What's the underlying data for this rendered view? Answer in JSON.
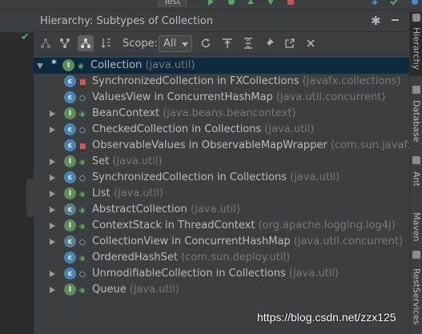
{
  "topbar": {
    "run_config": "Test"
  },
  "panel": {
    "title": "Hierarchy:  Subtypes of Collection"
  },
  "toolbar": {
    "scope_label": "Scope:",
    "scope_value": "All"
  },
  "tree": [
    {
      "indent": 0,
      "expander": "down",
      "star": "*",
      "icon": "interface",
      "letter": "I",
      "badge": "pub",
      "name": "Collection",
      "pkg": "(java.util)",
      "selected": true
    },
    {
      "indent": 1,
      "expander": "",
      "icon": "klass",
      "letter": "c",
      "badge": "priv",
      "name": "SynchronizedCollection in FXCollections",
      "pkg": "(javafx.collections)"
    },
    {
      "indent": 1,
      "expander": "",
      "icon": "klass",
      "letter": "c",
      "badge": "pkg",
      "name": "ValuesView in ConcurrentHashMap",
      "pkg": "(java.util.concurrent)"
    },
    {
      "indent": 1,
      "expander": "right",
      "icon": "interface",
      "letter": "I",
      "badge": "pub",
      "name": "BeanContext",
      "pkg": "(java.beans.beancontext)"
    },
    {
      "indent": 1,
      "expander": "right",
      "icon": "klass",
      "letter": "c",
      "badge": "pkg",
      "name": "CheckedCollection in Collections",
      "pkg": "(java.util)"
    },
    {
      "indent": 1,
      "expander": "",
      "icon": "klass",
      "letter": "c",
      "badge": "priv",
      "name": "ObservableValues in ObservableMapWrapper",
      "pkg": "(com.sun.javafx.collections)"
    },
    {
      "indent": 1,
      "expander": "right",
      "icon": "interface",
      "letter": "I",
      "badge": "pub",
      "name": "Set",
      "pkg": "(java.util)"
    },
    {
      "indent": 1,
      "expander": "right",
      "icon": "klass",
      "letter": "c",
      "badge": "pkg",
      "name": "SynchronizedCollection in Collections",
      "pkg": "(java.util)"
    },
    {
      "indent": 1,
      "expander": "right",
      "icon": "interface",
      "letter": "I",
      "badge": "pub",
      "name": "List",
      "pkg": "(java.util)"
    },
    {
      "indent": 1,
      "expander": "right",
      "icon": "abstract",
      "letter": "c",
      "badge": "pub",
      "name": "AbstractCollection",
      "pkg": "(java.util)"
    },
    {
      "indent": 1,
      "expander": "right",
      "icon": "interface",
      "letter": "I",
      "badge": "pub",
      "name": "ContextStack in ThreadContext",
      "pkg": "(org.apache.logging.log4j)"
    },
    {
      "indent": 1,
      "expander": "right",
      "icon": "abstract",
      "letter": "c",
      "badge": "pkg",
      "name": "CollectionView in ConcurrentHashMap",
      "pkg": "(java.util.concurrent)"
    },
    {
      "indent": 1,
      "expander": "",
      "icon": "klass",
      "letter": "c",
      "badge": "pub",
      "name": "OrderedHashSet",
      "pkg": "(com.sun.deploy.util)"
    },
    {
      "indent": 1,
      "expander": "right",
      "icon": "klass",
      "letter": "c",
      "badge": "pkg",
      "name": "UnmodifiableCollection in Collections",
      "pkg": "(java.util)"
    },
    {
      "indent": 1,
      "expander": "right",
      "icon": "interface",
      "letter": "I",
      "badge": "pub",
      "name": "Queue",
      "pkg": "(java.util)"
    }
  ],
  "right_strip": {
    "tabs": [
      {
        "label": "Hierarchy",
        "icon": "hierarchy-icon",
        "active": true
      },
      {
        "label": "Database",
        "icon": "database-icon",
        "active": false
      },
      {
        "label": "Ant",
        "icon": "ant-icon",
        "active": false
      },
      {
        "label": "Maven",
        "icon": "maven-icon",
        "active": false
      },
      {
        "label": "RestServices",
        "icon": "rest-services-icon",
        "active": false
      }
    ]
  },
  "watermark": "https://blog.csdn.net/zzx125",
  "colors": {
    "panel_bg": "#3c3f41",
    "selected_row": "#0d293e",
    "interface_icon": "#5e8e55",
    "class_icon": "#4a86b5",
    "package_text": "#787878",
    "text": "#bbbbbb"
  }
}
